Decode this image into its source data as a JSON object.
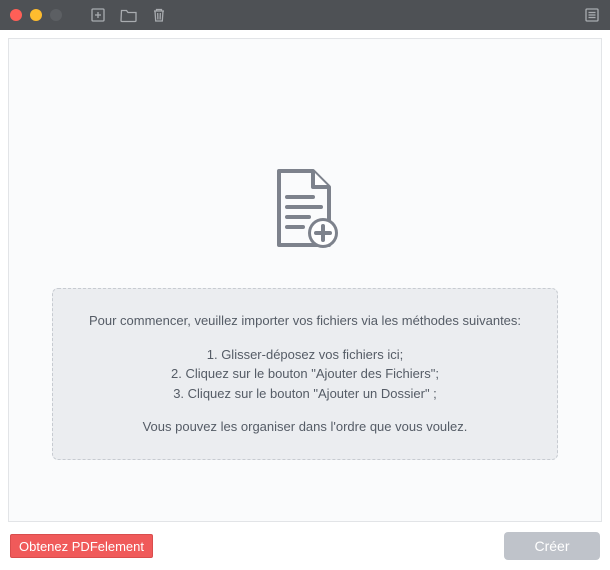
{
  "instructions": {
    "intro": "Pour commencer, veuillez importer vos fichiers via les méthodes suivantes:",
    "steps": [
      "1. Glisser-déposez vos fichiers ici;",
      "2. Cliquez sur le bouton \"Ajouter des Fichiers\";",
      "3. Cliquez sur le bouton \"Ajouter un Dossier\" ;"
    ],
    "outro": "Vous pouvez les organiser dans l'ordre que vous voulez."
  },
  "buttons": {
    "get_pdfelement": "Obtenez PDFelement",
    "create": "Créer"
  }
}
